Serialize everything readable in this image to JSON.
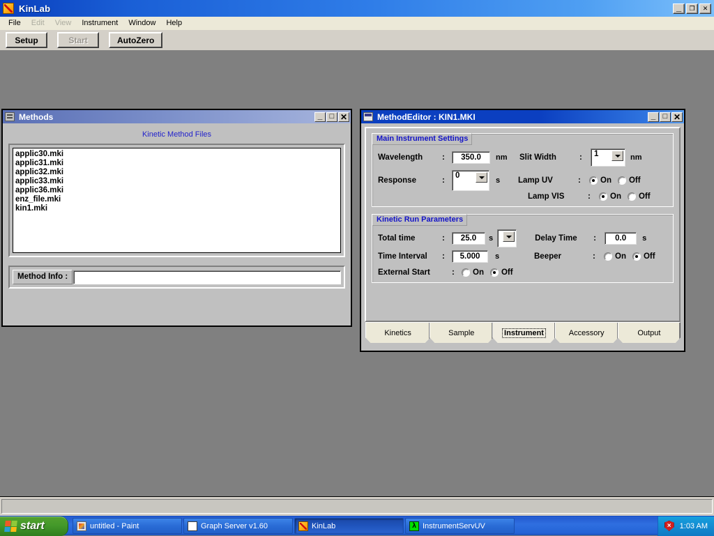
{
  "app": {
    "title": "KinLab",
    "icon": "kinlab-chart-icon",
    "caption_buttons": [
      {
        "name": "minimize",
        "glyph": "_"
      },
      {
        "name": "restore",
        "glyph": "❐"
      },
      {
        "name": "close",
        "glyph": "✕"
      }
    ],
    "menu": [
      {
        "label": "File",
        "enabled": true
      },
      {
        "label": "Edit",
        "enabled": false
      },
      {
        "label": "View",
        "enabled": false
      },
      {
        "label": "Instrument",
        "enabled": true
      },
      {
        "label": "Window",
        "enabled": true
      },
      {
        "label": "Help",
        "enabled": true
      }
    ],
    "toolbar": [
      {
        "label": "Setup",
        "enabled": true
      },
      {
        "label": "Start",
        "enabled": false
      },
      {
        "label": "AutoZero",
        "enabled": true
      }
    ],
    "statusbar_text": ""
  },
  "methods_window": {
    "title": "Methods",
    "icon": "document-icon",
    "active": false,
    "caption_buttons": [
      {
        "name": "minimize",
        "glyph": "_"
      },
      {
        "name": "maximize",
        "glyph": "□"
      },
      {
        "name": "close",
        "glyph": "✕"
      }
    ],
    "heading": "Kinetic Method Files",
    "file_list": [
      "applic30.mki",
      "applic31.mki",
      "applic32.mki",
      "applic33.mki",
      "applic36.mki",
      "enz_file.mki",
      "kin1.mki"
    ],
    "method_info_label": "Method Info :",
    "method_info_value": "",
    "method_info_placeholder": ""
  },
  "editor_window": {
    "title": "MethodEditor : KIN1.MKI",
    "icon": "method-editor-icon",
    "active": true,
    "caption_buttons": [
      {
        "name": "minimize",
        "glyph": "_"
      },
      {
        "name": "maximize",
        "glyph": "□"
      },
      {
        "name": "close",
        "glyph": "✕"
      }
    ],
    "main_settings": {
      "group_title": "Main Instrument Settings",
      "wavelength": {
        "label": "Wavelength",
        "colon": ":",
        "value": "350.0",
        "unit": "nm"
      },
      "response": {
        "label": "Response",
        "colon": ":",
        "value": "0",
        "unit": "s"
      },
      "slit_width": {
        "label": "Slit Width",
        "colon": ":",
        "value": "1",
        "unit": "nm"
      },
      "lamp_uv": {
        "label": "Lamp UV",
        "colon": ":",
        "on_label": "On",
        "off_label": "Off",
        "selected": "On"
      },
      "lamp_vis": {
        "label": "Lamp VIS",
        "colon": ":",
        "on_label": "On",
        "off_label": "Off",
        "selected": "On"
      }
    },
    "kinetic_params": {
      "group_title": "Kinetic Run Parameters",
      "total_time": {
        "label": "Total time",
        "colon": ":",
        "value": "25.0",
        "unit": "s"
      },
      "time_interval": {
        "label": "Time Interval",
        "colon": ":",
        "value": "5.000",
        "unit": "s"
      },
      "delay_time": {
        "label": "Delay Time",
        "colon": ":",
        "value": "0.0",
        "unit": "s"
      },
      "beeper": {
        "label": "Beeper",
        "colon": ":",
        "on_label": "On",
        "off_label": "Off",
        "selected": "Off"
      },
      "external_start": {
        "label": "External Start",
        "colon": ":",
        "on_label": "On",
        "off_label": "Off",
        "selected": "Off"
      }
    },
    "tabs": [
      {
        "label": "Kinetics",
        "selected": false
      },
      {
        "label": "Sample",
        "selected": false
      },
      {
        "label": "Instrument",
        "selected": true
      },
      {
        "label": "Accessory",
        "selected": false
      },
      {
        "label": "Output",
        "selected": false
      }
    ]
  },
  "taskbar": {
    "start_label": "start",
    "tasks": [
      {
        "label": "untitled - Paint",
        "icon": "paint-icon",
        "active": false
      },
      {
        "label": "Graph Server v1.60",
        "icon": "graph-icon",
        "active": false
      },
      {
        "label": "KinLab",
        "icon": "kinlab-icon",
        "active": true
      },
      {
        "label": "InstrumentServUV",
        "icon": "isuv-icon",
        "active": false
      }
    ],
    "tray": {
      "shield_icon": "security-shield-icon",
      "clock": "1:03 AM"
    }
  },
  "colors": {
    "titlebar_active": "#0b3fc0",
    "titlebar_inactive": "#7a8ec9",
    "group_title": "#1414c8",
    "heading": "#2222cc",
    "face": "#c0c0c0",
    "desktop": "#808080",
    "menubar": "#ece9d8",
    "taskbar": "#2f6fe0",
    "start_green": "#44992a"
  }
}
